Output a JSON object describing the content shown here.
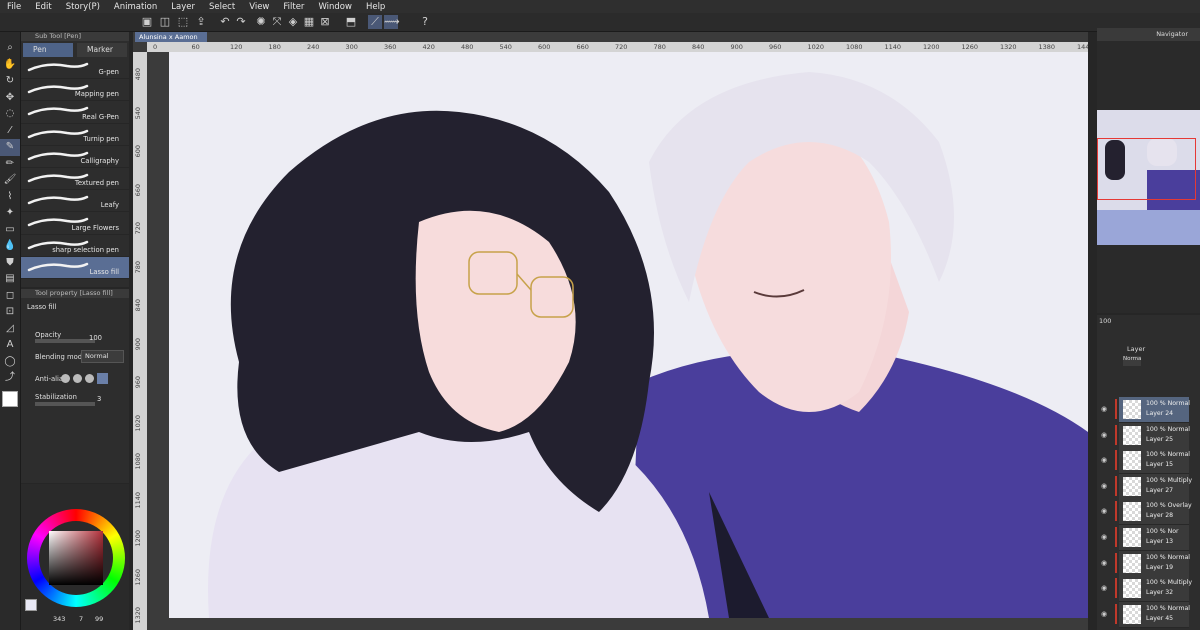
{
  "menu": [
    "File",
    "Edit",
    "Story(P)",
    "Animation",
    "Layer",
    "Select",
    "View",
    "Filter",
    "Window",
    "Help"
  ],
  "document_tab": "Alunsina x Aamon",
  "subtool": {
    "header": "Sub Tool [Pen]",
    "tabs": [
      "Pen",
      "Marker"
    ],
    "brushes": [
      "G-pen",
      "Mapping pen",
      "Real G-Pen",
      "Turnip pen",
      "Calligraphy",
      "Textured pen",
      "Leafy",
      "Large Flowers",
      "sharp selection pen",
      "Lasso fill"
    ],
    "selected": "Lasso fill"
  },
  "tool_property": {
    "header": "Tool property [Lasso fill]",
    "tool_name": "Lasso fill",
    "opacity_label": "Opacity",
    "opacity_value": "100",
    "blend_label": "Blending mode",
    "blend_value": "Normal",
    "antialias_label": "Anti-alias",
    "stabilization_label": "Stabilization",
    "stabilization_value": "3"
  },
  "color": {
    "hue_sv": "#b3303a",
    "status_a": "343",
    "status_b": "7",
    "status_c": "99"
  },
  "ruler": {
    "top": [
      "0",
      "60",
      "120",
      "180",
      "240",
      "300",
      "360",
      "420",
      "480",
      "540",
      "600",
      "660",
      "720",
      "780",
      "840",
      "900",
      "960",
      "1020",
      "1080",
      "1140",
      "1200",
      "1260",
      "1320",
      "1380",
      "144"
    ],
    "left": [
      "480",
      "540",
      "600",
      "660",
      "720",
      "780",
      "840",
      "900",
      "960",
      "1020",
      "1080",
      "1140",
      "1200",
      "1260",
      "1320"
    ]
  },
  "navigator": {
    "title": "Navigator"
  },
  "layer_panel": {
    "title": "Layer",
    "opacity": "100",
    "mode": "Normal",
    "layers": [
      {
        "mode": "100 % Normal",
        "name": "Layer 24",
        "selected": true
      },
      {
        "mode": "100 % Normal",
        "name": "Layer 25",
        "selected": false
      },
      {
        "mode": "100 % Normal",
        "name": "Layer 15",
        "selected": false
      },
      {
        "mode": "100 % Multiply",
        "name": "Layer 27",
        "selected": false
      },
      {
        "mode": "100 % Overlay",
        "name": "Layer 28",
        "selected": false
      },
      {
        "mode": "100 % Nor",
        "name": "Layer 13",
        "selected": false
      },
      {
        "mode": "100 % Normal",
        "name": "Layer 19",
        "selected": false
      },
      {
        "mode": "100 % Multiply",
        "name": "Layer 32",
        "selected": false
      },
      {
        "mode": "100 % Normal",
        "name": "Layer 45",
        "selected": false
      }
    ]
  }
}
